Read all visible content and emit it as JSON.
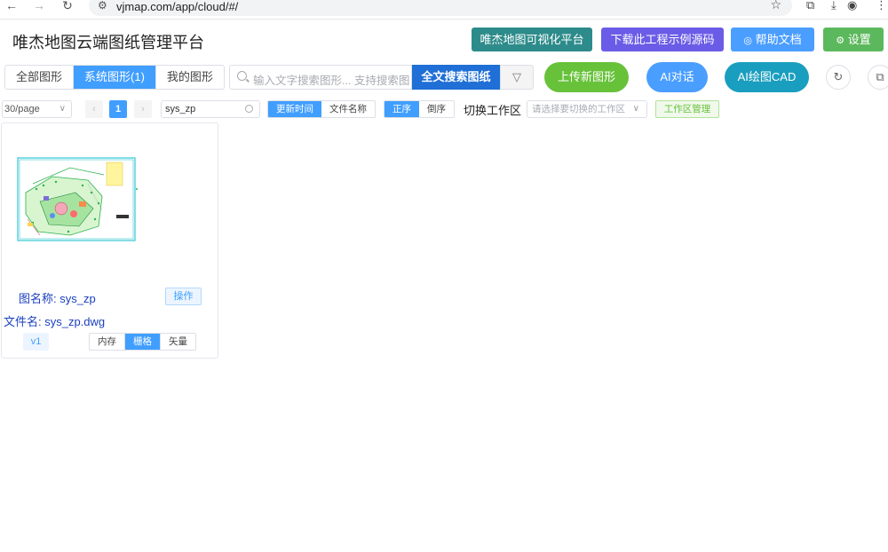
{
  "browser": {
    "url": "vjmap.com/app/cloud/#/"
  },
  "header": {
    "title": "唯杰地图云端图纸管理平台",
    "buttons": [
      {
        "label": "唯杰地图可视化平台",
        "color": "#2e8b8b"
      },
      {
        "label": "下载此工程示例源码",
        "color": "#6b5ce7"
      },
      {
        "label": "帮助文档",
        "icon": "help-circle-icon",
        "color": "#4a9eff"
      },
      {
        "label": "设置",
        "icon": "gear-icon",
        "color": "#5cb85c"
      }
    ]
  },
  "toolbar": {
    "tabs": [
      {
        "label": "全部图形",
        "active": false
      },
      {
        "label": "系统图形(1)",
        "active": true
      },
      {
        "label": "我的图形",
        "active": false
      }
    ],
    "search_placeholder": "输入文字搜索图形... 支持搜索图",
    "fulltext_label": "全文搜索图纸",
    "upload_label": "上传新图形",
    "ai_chat_label": "AI对话",
    "ai_cad_label": "AI绘图CAD",
    "colors": {
      "upload": "#67c23a",
      "ai_chat": "#4a9eff",
      "ai_cad": "#1a9ebf"
    }
  },
  "filters": {
    "page_size": "30/page",
    "current_page": "1",
    "filter_value": "sys_zp",
    "sort_fields": [
      {
        "label": "更新时间",
        "active": true
      },
      {
        "label": "文件名称",
        "active": false
      }
    ],
    "sort_orders": [
      {
        "label": "正序",
        "active": true
      },
      {
        "label": "倒序",
        "active": false
      }
    ],
    "workspace_label": "切换工作区",
    "workspace_placeholder": "请选择要切换的工作区",
    "workspace_manage_label": "工作区管理"
  },
  "cards": [
    {
      "map_name_label": "图名称: sys_zp",
      "operate_label": "操作",
      "file_name_label": "文件名: sys_zp.dwg",
      "version": "v1",
      "modes": [
        {
          "label": "内存",
          "active": false
        },
        {
          "label": "栅格",
          "active": true
        },
        {
          "label": "矢量",
          "active": false
        }
      ]
    }
  ]
}
